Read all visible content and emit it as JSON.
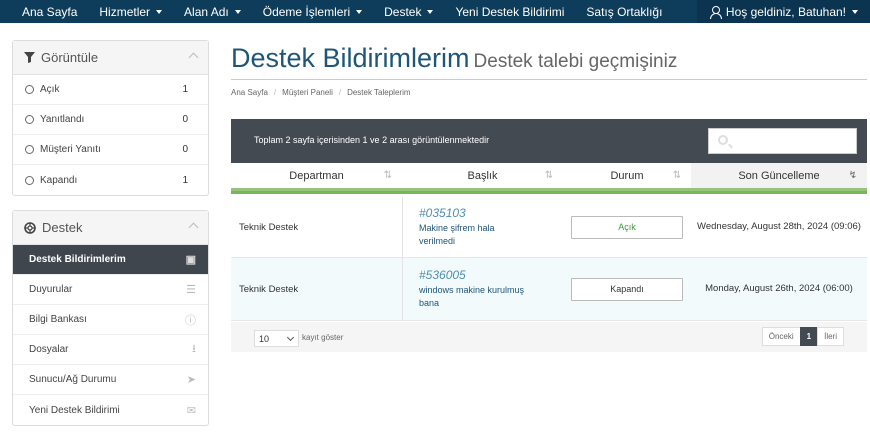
{
  "nav": {
    "items": [
      {
        "label": "Ana Sayfa",
        "caret": false
      },
      {
        "label": "Hizmetler",
        "caret": true
      },
      {
        "label": "Alan Adı",
        "caret": true
      },
      {
        "label": "Ödeme İşlemleri",
        "caret": true
      },
      {
        "label": "Destek",
        "caret": true
      },
      {
        "label": "Yeni Destek Bildirimi",
        "caret": false
      },
      {
        "label": "Satış Ortaklığı",
        "caret": false
      }
    ],
    "user_greeting": "Hoş geldiniz, Batuhan!",
    "icon": "user-icon"
  },
  "sidebar": {
    "filter": {
      "title": "Görüntüle",
      "icon": "filter-icon",
      "items": [
        {
          "label": "Açık",
          "count": "1"
        },
        {
          "label": "Yanıtlandı",
          "count": "0"
        },
        {
          "label": "Müşteri Yanıtı",
          "count": "0"
        },
        {
          "label": "Kapandı",
          "count": "1"
        }
      ]
    },
    "support": {
      "title": "Destek",
      "icon": "lifebuoy-icon",
      "items": [
        {
          "label": "Destek Bildirimlerim",
          "icon": "ticket-icon",
          "active": true
        },
        {
          "label": "Duyurular",
          "icon": "list-icon",
          "active": false
        },
        {
          "label": "Bilgi Bankası",
          "icon": "info-icon",
          "active": false
        },
        {
          "label": "Dosyalar",
          "icon": "download-icon",
          "active": false
        },
        {
          "label": "Sunucu/Ağ Durumu",
          "icon": "rocket-icon",
          "active": false
        },
        {
          "label": "Yeni Destek Bildirimi",
          "icon": "chat-icon",
          "active": false
        }
      ]
    }
  },
  "page": {
    "title": "Destek Bildirimlerim",
    "subtitle": "Destek talebi geçmişiniz",
    "breadcrumb": [
      "Ana Sayfa",
      "Müşteri Paneli",
      "Destek Taleplerim"
    ]
  },
  "table": {
    "info": "Toplam 2 sayfa içerisinden 1 ve 2 arası görüntülenmektedir",
    "search_placeholder": "",
    "columns": [
      "Departman",
      "Başlık",
      "Durum",
      "Son Güncelleme"
    ],
    "rows": [
      {
        "department": "Teknik Destek",
        "id": "#035103",
        "subject": "Makine şifrem hala verilmedi",
        "status": "Açık",
        "updated": "Wednesday, August 28th, 2024 (09:06)"
      },
      {
        "department": "Teknik Destek",
        "id": "#536005",
        "subject": "windows makine kurulmuş bana",
        "status": "Kapandı",
        "updated": "Monday, August 26th, 2024 (06:00)"
      }
    ],
    "length_value": "10",
    "length_label": "kayıt göster",
    "pager": {
      "prev": "Önceki",
      "current": "1",
      "next": "İleri"
    },
    "colors": {
      "header_bar": "#434a52",
      "accent_green": "#96c47b",
      "status_open": "#3a9b3a",
      "nav_bg": "#0e3d5b"
    }
  }
}
